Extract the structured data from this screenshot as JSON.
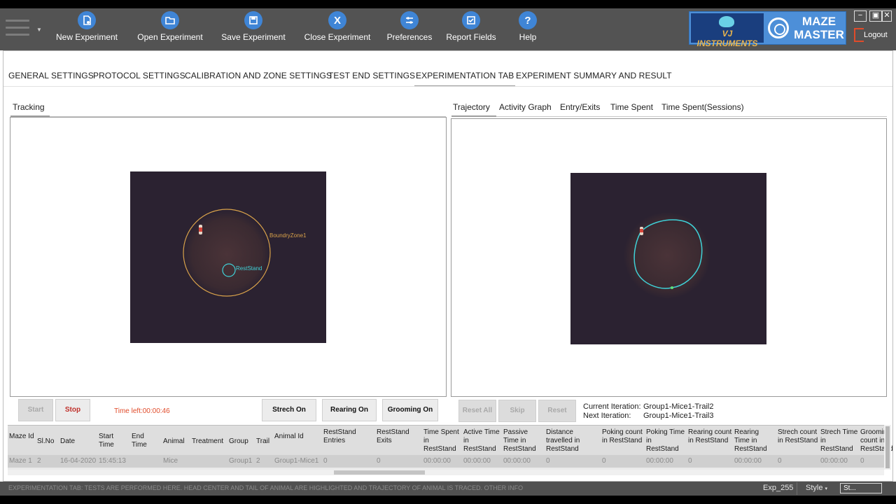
{
  "toolbar": {
    "buttons": [
      {
        "label": "New Experiment",
        "icon": "new-document-icon"
      },
      {
        "label": "Open Experiment",
        "icon": "folder-icon"
      },
      {
        "label": "Save Experiment",
        "icon": "save-icon"
      },
      {
        "label": "Close Experiment",
        "icon": "close-icon",
        "glyph": "X"
      },
      {
        "label": "Preferences",
        "icon": "sliders-icon"
      },
      {
        "label": "Report Fields",
        "icon": "checklist-icon"
      },
      {
        "label": "Help",
        "icon": "help-icon",
        "glyph": "?"
      }
    ],
    "brand_left": "VJ INSTRUMENTS",
    "brand_right": "MAZE MASTER",
    "window_controls": [
      "−",
      "▣",
      "✕"
    ],
    "logout": "Logout",
    "accent_color": "#3f85d6"
  },
  "tabs": [
    {
      "label": "GENERAL SETTINGS"
    },
    {
      "label": "PROTOCOL SETTINGS"
    },
    {
      "label": "CALIBRATION AND ZONE SETTINGS"
    },
    {
      "label": "TEST END SETTINGS"
    },
    {
      "label": "EXPERIMENTATION TAB",
      "active": true
    },
    {
      "label": "EXPERIMENT SUMMARY AND RESULT"
    }
  ],
  "left_panel": {
    "tab": "Tracking",
    "zone_labels": {
      "boundary": "BoundryZone1",
      "rest": "RestStand"
    }
  },
  "right_panel": {
    "tabs": [
      "Trajectory",
      "Activity Graph",
      "Entry/Exits",
      "Time Spent",
      "Time Spent(Sessions)"
    ]
  },
  "controls": {
    "start": "Start",
    "stop": "Stop",
    "timer": "Time left:00:00:46",
    "strech": "Strech On",
    "rearing": "Rearing On",
    "grooming": "Grooming On",
    "reset_all": "Reset All",
    "skip": "Skip",
    "reset": "Reset",
    "current_iteration_label": "Current Iteration:",
    "current_iteration_value": "Group1-Mice1-Trail2",
    "next_iteration_label": "Next Iteration:",
    "next_iteration_value": "Group1-Mice1-Trail3"
  },
  "table": {
    "headers": [
      "Maze Id",
      "Sl.No",
      "Date",
      "Start Time",
      "End Time",
      "Animal",
      "Treatment",
      "Group",
      "Trail",
      "Animal Id",
      "RestStand Entries",
      "RestStand Exits",
      "Time Spent in RestStand",
      "Active Time in RestStand",
      "Passive Time in RestStand",
      "Distance travelled in RestStand",
      "Poking count in RestStand",
      "Poking Time in RestStand",
      "Rearing count in RestStand",
      "Rearing Time in RestStand",
      "Strech count in RestStand",
      "Strech Time in RestStand",
      "Grooming count in RestStand"
    ],
    "row": [
      "Maze 1",
      "2",
      "16-04-2020",
      "15:45:13",
      "",
      "Mice",
      "",
      "Group1",
      "2",
      "Group1-Mice1",
      "0",
      "0",
      "00:00:00",
      "00:00:00",
      "00:00:00",
      "0",
      "0",
      "00:00:00",
      "0",
      "00:00:00",
      "0",
      "00:00:00",
      "0"
    ]
  },
  "status": {
    "message": "EXPERIMENTATION TAB: TESTS ARE PERFORMED HERE. HEAD CENTER AND TAIL OF ANIMAL ARE HIGHLIGHTED AND TRAJECTORY OF ANIMAL IS TRACED. OTHER INFO",
    "experiment": "Exp_255",
    "style": "Style",
    "st": "St..."
  }
}
